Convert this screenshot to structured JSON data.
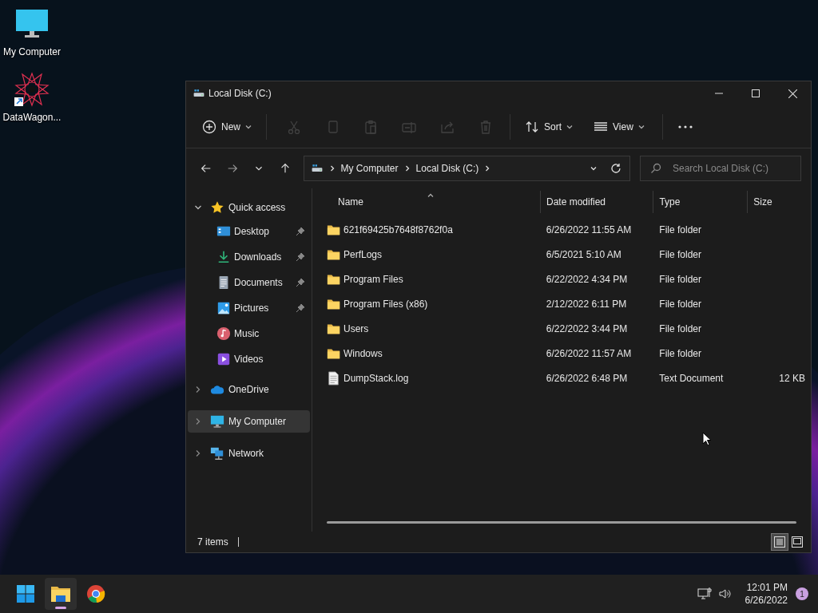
{
  "desktop_icons": [
    {
      "label": "My Computer",
      "kind": "computer"
    },
    {
      "label": "DataWagon...",
      "kind": "app"
    }
  ],
  "window": {
    "title": "Local Disk (C:)"
  },
  "toolbar": [
    {
      "kind": "new",
      "label": "New",
      "disabled": false
    },
    {
      "kind": "cut",
      "disabled": true
    },
    {
      "kind": "copy",
      "disabled": true
    },
    {
      "kind": "paste",
      "disabled": true
    },
    {
      "kind": "rename",
      "disabled": true
    },
    {
      "kind": "share",
      "disabled": true
    },
    {
      "kind": "delete",
      "disabled": true
    },
    {
      "kind": "sort",
      "label": "Sort",
      "disabled": false
    },
    {
      "kind": "view",
      "label": "View",
      "disabled": false
    },
    {
      "kind": "more",
      "disabled": false
    }
  ],
  "address": {
    "crumbs": [
      "My Computer",
      "Local Disk (C:)"
    ],
    "search_placeholder": "Search Local Disk (C:)"
  },
  "nav": [
    {
      "label": "Quick access",
      "kind": "star",
      "expanded": true,
      "selected": false,
      "children": [
        {
          "label": "Desktop",
          "kind": "desktop",
          "pinned": true,
          "selected": false
        },
        {
          "label": "Downloads",
          "kind": "downloads",
          "pinned": true,
          "selected": false
        },
        {
          "label": "Documents",
          "kind": "documents",
          "pinned": true,
          "selected": false
        },
        {
          "label": "Pictures",
          "kind": "pictures",
          "pinned": true,
          "selected": false
        },
        {
          "label": "Music",
          "kind": "music",
          "pinned": false,
          "selected": false
        },
        {
          "label": "Videos",
          "kind": "videos",
          "pinned": false,
          "selected": false
        }
      ]
    },
    {
      "label": "OneDrive",
      "kind": "cloud",
      "expanded": false,
      "selected": false
    },
    {
      "label": "My Computer",
      "kind": "computer",
      "expanded": false,
      "selected": true
    },
    {
      "label": "Network",
      "kind": "network",
      "expanded": false,
      "selected": false
    }
  ],
  "columns": [
    "Name",
    "Date modified",
    "Type",
    "Size"
  ],
  "rows": [
    {
      "kind": "folder",
      "name": "621f69425b7648f8762f0a",
      "date": "6/26/2022 11:55 AM",
      "type": "File folder"
    },
    {
      "kind": "folder",
      "name": "PerfLogs",
      "date": "6/5/2021 5:10 AM",
      "type": "File folder"
    },
    {
      "kind": "folder",
      "name": "Program Files",
      "date": "6/22/2022 4:34 PM",
      "type": "File folder"
    },
    {
      "kind": "folder",
      "name": "Program Files (x86)",
      "date": "2/12/2022 6:11 PM",
      "type": "File folder"
    },
    {
      "kind": "folder",
      "name": "Users",
      "date": "6/22/2022 3:44 PM",
      "type": "File folder"
    },
    {
      "kind": "folder",
      "name": "Windows",
      "date": "6/26/2022 11:57 AM",
      "type": "File folder"
    },
    {
      "kind": "file",
      "name": "DumpStack.log",
      "date": "6/26/2022 6:48 PM",
      "type": "Text Document",
      "size": "12 KB"
    }
  ],
  "status": {
    "count": "7 items",
    "views": [
      {
        "kind": "details",
        "selected": true
      },
      {
        "kind": "tiles",
        "selected": false
      }
    ]
  },
  "taskbar": {
    "apps": [
      {
        "kind": "start",
        "active": false
      },
      {
        "kind": "explorer",
        "active": true
      },
      {
        "kind": "chrome",
        "active": false
      }
    ],
    "time": "12:01 PM",
    "date": "6/26/2022",
    "badge": "1"
  }
}
